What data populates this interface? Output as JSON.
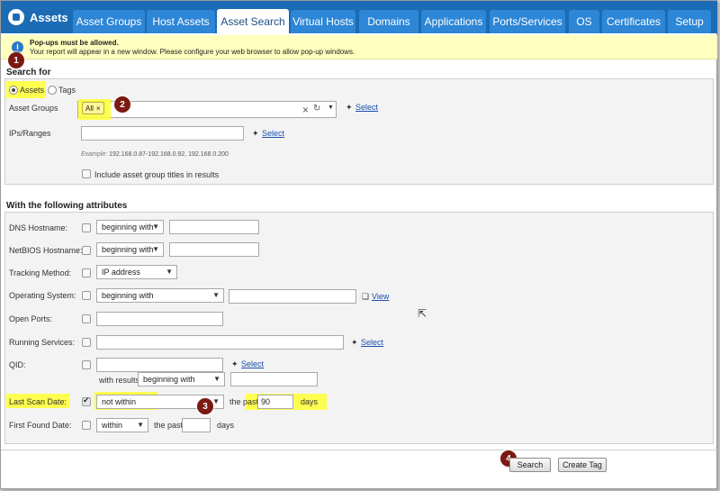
{
  "app": {
    "logo_text": "Assets"
  },
  "nav": {
    "tabs": [
      {
        "label": "Asset Groups"
      },
      {
        "label": "Host Assets"
      },
      {
        "label": "Asset Search",
        "active": true
      },
      {
        "label": "Virtual Hosts"
      },
      {
        "label": "Domains"
      },
      {
        "label": "Applications"
      },
      {
        "label": "Ports/Services"
      },
      {
        "label": "OS"
      },
      {
        "label": "Certificates"
      },
      {
        "label": "Setup"
      }
    ]
  },
  "banner": {
    "title": "Pop-ups must be allowed.",
    "message": "Your report will appear in a new window. Please configure your web browser to allow pop-up windows."
  },
  "search_for": {
    "heading": "Search for",
    "option_assets": "Assets",
    "option_tags": "Tags",
    "selected": "Assets",
    "asset_groups_label": "Asset Groups",
    "asset_groups_chip": "All",
    "select_link": "Select",
    "ips_label": "IPs/Ranges",
    "ips_value": "",
    "example_prefix": "Example:",
    "example_value": "192.168.0.87-192.168.0.92, 192.168.0.200",
    "include_titles_label": "Include asset group titles in results"
  },
  "attributes": {
    "heading": "With the following attributes",
    "dns_label": "DNS Hostname:",
    "dns_mode": "beginning with",
    "netbios_label": "NetBIOS Hostname:",
    "netbios_mode": "beginning with",
    "tracking_label": "Tracking Method:",
    "tracking_value": "IP address",
    "os_label": "Operating System:",
    "os_mode": "beginning with",
    "os_view_link": "View",
    "ports_label": "Open Ports:",
    "services_label": "Running Services:",
    "services_select_link": "Select",
    "qid_label": "QID:",
    "qid_select_link": "Select",
    "qid_with_results": "with results",
    "qid_mode": "beginning with",
    "last_scan_label": "Last Scan Date:",
    "last_scan_mode": "not within",
    "last_scan_the_past": "the past",
    "last_scan_value": "90",
    "last_scan_unit": "days",
    "first_found_label": "First Found Date:",
    "first_found_mode": "within",
    "first_found_the_past": "the past",
    "first_found_unit": "days"
  },
  "buttons": {
    "search": "Search",
    "create_tag": "Create Tag"
  },
  "badges": [
    "1",
    "2",
    "3",
    "4"
  ]
}
